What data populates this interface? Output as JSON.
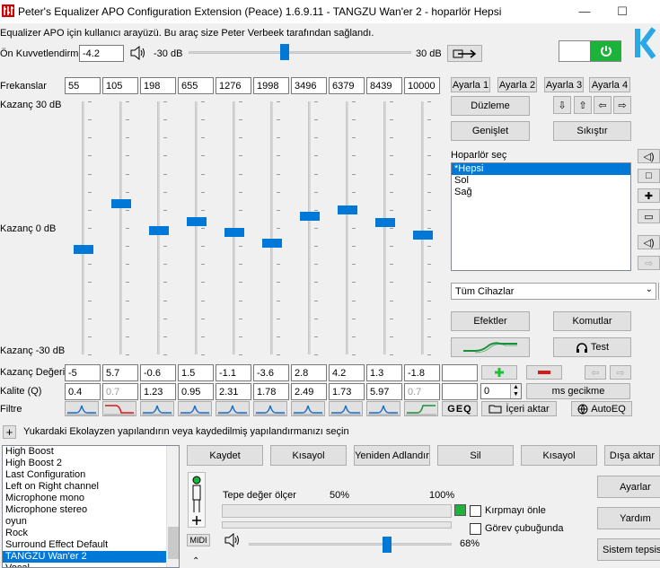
{
  "window": {
    "title": "Peter's Equalizer APO Configuration Extension (Peace) 1.6.9.11 - TANGZU Wan'er 2 - hoparlör Hepsi",
    "minimize": "—",
    "maximize": "☐"
  },
  "info_text": "Equalizer APO için kullanıcı arayüzü. Bu araç size Peter Verbeek tarafından sağlandı.",
  "preamp": {
    "label": "Ön Kuvvetlendirme",
    "value": "-4.2",
    "min_label": "-30 dB",
    "max_label": "30 dB",
    "level_db": -4.2
  },
  "freq_label": "Frekanslar",
  "gain_top_label": "Kazanç 30 dB",
  "gain_mid_label": "Kazanç 0 dB",
  "gain_bottom_label": "Kazanç -30 dB",
  "gain_value_label": "Kazanç Değeri",
  "quality_label": "Kalite (Q)",
  "filter_label": "Filtre",
  "bands": [
    {
      "freq": "55",
      "gain": "-5",
      "q": "0.4",
      "q_dim": false,
      "gain_db": -5
    },
    {
      "freq": "105",
      "gain": "5.7",
      "q": "0.7",
      "q_dim": true,
      "gain_db": 5.7
    },
    {
      "freq": "198",
      "gain": "-0.6",
      "q": "1.23",
      "q_dim": false,
      "gain_db": -0.6
    },
    {
      "freq": "655",
      "gain": "1.5",
      "q": "0.95",
      "q_dim": false,
      "gain_db": 1.5
    },
    {
      "freq": "1276",
      "gain": "-1.1",
      "q": "2.31",
      "q_dim": false,
      "gain_db": -1.1
    },
    {
      "freq": "1998",
      "gain": "-3.6",
      "q": "1.78",
      "q_dim": false,
      "gain_db": -3.6
    },
    {
      "freq": "3496",
      "gain": "2.8",
      "q": "2.49",
      "q_dim": false,
      "gain_db": 2.8
    },
    {
      "freq": "6379",
      "gain": "4.2",
      "q": "1.73",
      "q_dim": false,
      "gain_db": 4.2
    },
    {
      "freq": "8439",
      "gain": "1.3",
      "q": "5.97",
      "q_dim": false,
      "gain_db": 1.3
    },
    {
      "freq": "10000",
      "gain": "-1.8",
      "q": "0.7",
      "q_dim": true,
      "gain_db": -1.8
    }
  ],
  "settings_buttons": [
    "Ayarla 1",
    "Ayarla 2",
    "Ayarla 3",
    "Ayarla 4"
  ],
  "buttons": {
    "flatten": "Düzleme",
    "expand": "Genişlet",
    "compress": "Sıkıştır",
    "effects": "Efektler",
    "commands": "Komutlar",
    "test": "Test",
    "geq": "GEQ",
    "import": "İçeri aktar",
    "autoeq": "AutoEQ",
    "ms_delay": "ms gecikme",
    "delay_value": "0"
  },
  "speaker": {
    "label": "Hoparlör seç",
    "items": [
      "*Hepsi",
      "Sol",
      "Sağ"
    ],
    "selected": 0
  },
  "device_select": "Tüm Cihazlar",
  "save_prompt": "Yukardaki Ekolayzen  yapılandırın veya kaydedilmiş yapılandırmanızı seçin",
  "configs": [
    "High Boost",
    "High Boost 2",
    "Last Configuration",
    "Left on Right channel",
    "Microphone mono",
    "Microphone stereo",
    "oyun",
    "Rock",
    "Surround Effect Default",
    "TANGZU Wan'er 2",
    "Vocal"
  ],
  "config_selected": 9,
  "config_buttons": [
    "Kaydet",
    "Kısayol",
    "Yeniden Adlandır",
    "Sil",
    "Kısayol",
    "Dışa aktar"
  ],
  "peak": {
    "label": "Tepe değer ölçer",
    "pct50": "50%",
    "pct100": "100%"
  },
  "clip_label": "Kırpmayı önle",
  "taskbar_label": "Görev çubuğunda",
  "volume": {
    "value": "68%",
    "level": 0.68
  },
  "midi_label": "MIDI",
  "right_buttons": [
    "Ayarlar",
    "Yardım",
    "Sistem tepsisi"
  ],
  "colors": {
    "accent": "#0078d7",
    "power_green": "#1db33a",
    "logo_blue": "#2aa7e6",
    "red": "#d51a1a",
    "plus_green": "#1fbf3d"
  }
}
